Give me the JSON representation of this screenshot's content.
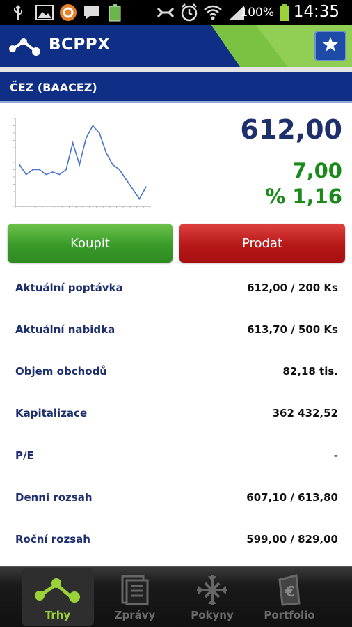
{
  "status_bar": {
    "battery_percent": "100%",
    "time": "14:35",
    "icons": [
      "usb-icon",
      "gallery-icon",
      "app-icon",
      "message-icon",
      "battery-small-icon",
      "mute-icon",
      "alarm-icon",
      "wifi-icon",
      "signal-icon",
      "battery-icon"
    ]
  },
  "app": {
    "title": "BCPPX",
    "colors": {
      "header_blue": "#0f2f86",
      "header_green": "#7cc242",
      "buy": "#3a9b2a",
      "sell": "#b71818"
    }
  },
  "stock": {
    "name": "ČEZ (BAACEZ)",
    "price": "612,00",
    "change": "7,00",
    "change_pct": "% 1,16"
  },
  "chart_data": {
    "type": "line",
    "title": "",
    "xlabel": "",
    "ylabel": "",
    "values": [
      47,
      43,
      45,
      45,
      43,
      44,
      43,
      45,
      56,
      47,
      58,
      63,
      60,
      52,
      47,
      45,
      41,
      37,
      33,
      38
    ],
    "ylim": [
      30,
      66
    ]
  },
  "actions": {
    "buy_label": "Koupit",
    "sell_label": "Prodat"
  },
  "details": [
    {
      "label": "Aktuální poptávka",
      "value": "612,00 / 200 Ks"
    },
    {
      "label": "Aktuální nabidka",
      "value": "613,70 / 500 Ks"
    },
    {
      "label": "Objem obchodů",
      "value": "82,18 tis."
    },
    {
      "label": "Kapitalizace",
      "value": "362 432,52"
    },
    {
      "label": "P/E",
      "value": "-"
    },
    {
      "label": "Denni rozsah",
      "value": "607,10 / 613,80"
    },
    {
      "label": "Roční rozsah",
      "value": "599,00 / 829,00"
    }
  ],
  "nav": {
    "items": [
      {
        "label": "Trhy",
        "icon": "markets-icon",
        "active": true
      },
      {
        "label": "Zprávy",
        "icon": "news-icon",
        "active": false
      },
      {
        "label": "Pokyny",
        "icon": "orders-icon",
        "active": false
      },
      {
        "label": "Portfolio",
        "icon": "portfolio-icon",
        "active": false
      }
    ]
  }
}
